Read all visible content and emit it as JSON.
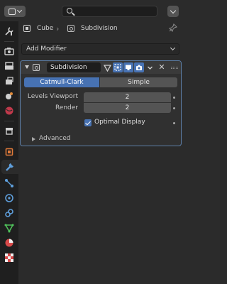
{
  "header": {
    "editor_type_icon": "properties-editor-icon",
    "search_placeholder": ""
  },
  "breadcrumb": {
    "object": "Cube",
    "modifier": "Subdivision"
  },
  "add_modifier_label": "Add Modifier",
  "modifier": {
    "name": "Subdivision",
    "algorithm_options": [
      "Catmull-Clark",
      "Simple"
    ],
    "selected_algorithm": "Catmull-Clark",
    "levels_viewport_label": "Levels Viewport",
    "levels_viewport_value": "2",
    "render_label": "Render",
    "render_value": "2",
    "optimal_display_label": "Optimal Display",
    "optimal_display_checked": true,
    "advanced_label": "Advanced"
  },
  "sidebar_tabs": [
    "tool-icon",
    "render-icon",
    "output-icon",
    "view-layer-icon",
    "scene-icon",
    "world-icon",
    "collection-icon",
    "object-icon",
    "modifier-icon",
    "particles-icon",
    "physics-icon",
    "constraints-icon",
    "object-data-icon",
    "material-icon",
    "texture-icon"
  ],
  "colors": {
    "accent": "#4772b3",
    "panel_outline": "#5d7fa8",
    "background": "#2b2b2b",
    "tabbar": "#1f1f1f"
  }
}
